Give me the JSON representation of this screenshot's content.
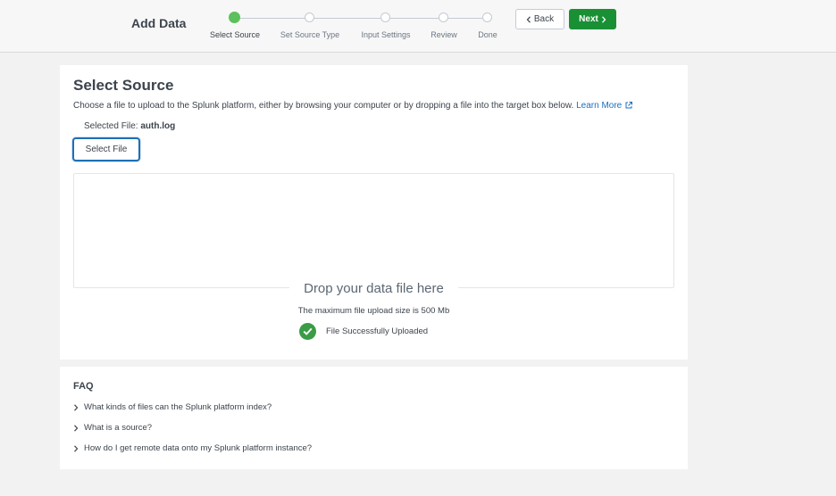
{
  "header": {
    "title": "Add Data",
    "steps": [
      {
        "label": "Select Source",
        "state": "active"
      },
      {
        "label": "Set Source Type",
        "state": "pending"
      },
      {
        "label": "Input Settings",
        "state": "pending"
      },
      {
        "label": "Review",
        "state": "pending"
      },
      {
        "label": "Done",
        "state": "pending"
      }
    ],
    "back_label": "Back",
    "next_label": "Next"
  },
  "main": {
    "title": "Select Source",
    "description": "Choose a file to upload to the Splunk platform, either by browsing your computer or by dropping a file into the target box below.",
    "learn_more": "Learn More",
    "selected_file_label": "Selected File:",
    "selected_file_name": "auth.log",
    "select_file_button": "Select File",
    "drop_heading": "Drop your data file here",
    "max_size_text": "The maximum file upload size is 500 Mb",
    "upload_status": "File Successfully Uploaded"
  },
  "faq": {
    "title": "FAQ",
    "items": [
      {
        "label": "What kinds of files can the Splunk platform index?"
      },
      {
        "label": "What is a source?"
      },
      {
        "label": "How do I get remote data onto my Splunk platform instance?"
      }
    ]
  },
  "colors": {
    "accent_green": "#5cc05c",
    "next_button": "#1a9035",
    "link_blue": "#1a6fbf",
    "success_check": "#3a9c46"
  }
}
